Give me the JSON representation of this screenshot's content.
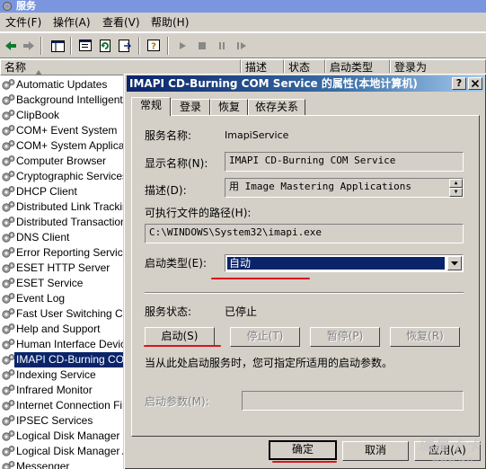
{
  "window": {
    "title": "服务"
  },
  "menu": [
    "文件(F)",
    "操作(A)",
    "查看(V)",
    "帮助(H)"
  ],
  "toolbar": [
    "back-icon",
    "forward-icon",
    "console-tree-icon",
    "properties-icon",
    "refresh-icon",
    "export-list-icon",
    "help-icon",
    "play-icon",
    "stop-icon",
    "pause-icon",
    "restart-icon"
  ],
  "columns": {
    "name": "名称",
    "description": "描述",
    "status": "状态",
    "startup_type": "启动类型",
    "logon_as": "登录为"
  },
  "services": [
    "Automatic Updates",
    "Background Intelligent Transfer Service",
    "ClipBook",
    "COM+ Event System",
    "COM+ System Application",
    "Computer Browser",
    "Cryptographic Services",
    "DHCP Client",
    "Distributed Link Tracking Client",
    "Distributed Transaction Coordinator",
    "DNS Client",
    "Error Reporting Service",
    "ESET HTTP Server",
    "ESET Service",
    "Event Log",
    "Fast User Switching Compatibility",
    "Help and Support",
    "Human Interface Device Access",
    "IMAPI CD-Burning COM Service",
    "Indexing Service",
    "Infrared Monitor",
    "Internet Connection Firewall",
    "IPSEC Services",
    "Logical Disk Manager",
    "Logical Disk Manager Administrative Service",
    "Messenger"
  ],
  "selected_service_index": 18,
  "dialog": {
    "title": "IMAPI CD-Burning COM Service 的属性(本地计算机)",
    "help_btn": "?",
    "close_btn": "X",
    "tabs": [
      "常规",
      "登录",
      "恢复",
      "依存关系"
    ],
    "service_name_label": "服务名称:",
    "service_name": "ImapiService",
    "display_name_label": "显示名称(N):",
    "display_name": "IMAPI CD-Burning COM Service",
    "description_label": "描述(D):",
    "description": "用 Image Mastering Applications",
    "path_label": "可执行文件的路径(H):",
    "path": "C:\\WINDOWS\\System32\\imapi.exe",
    "startup_type_label": "启动类型(E):",
    "startup_type": "自动",
    "status_label": "服务状态:",
    "status": "已停止",
    "buttons": {
      "start": "启动(S)",
      "stop": "停止(T)",
      "pause": "暂停(P)",
      "resume": "恢复(R)"
    },
    "hint": "当从此处启动服务时，您可指定所适用的启动参数。",
    "params_label": "启动参数(M):",
    "params_value": "",
    "ok": "确定",
    "cancel": "取消",
    "apply": "应用(A)"
  },
  "accent": {
    "highlight": "#0a246a",
    "annotation": "#d8141a"
  },
  "watermark": {
    "line1": "瑞星卡卡",
    "line2": "www.jka..."
  }
}
